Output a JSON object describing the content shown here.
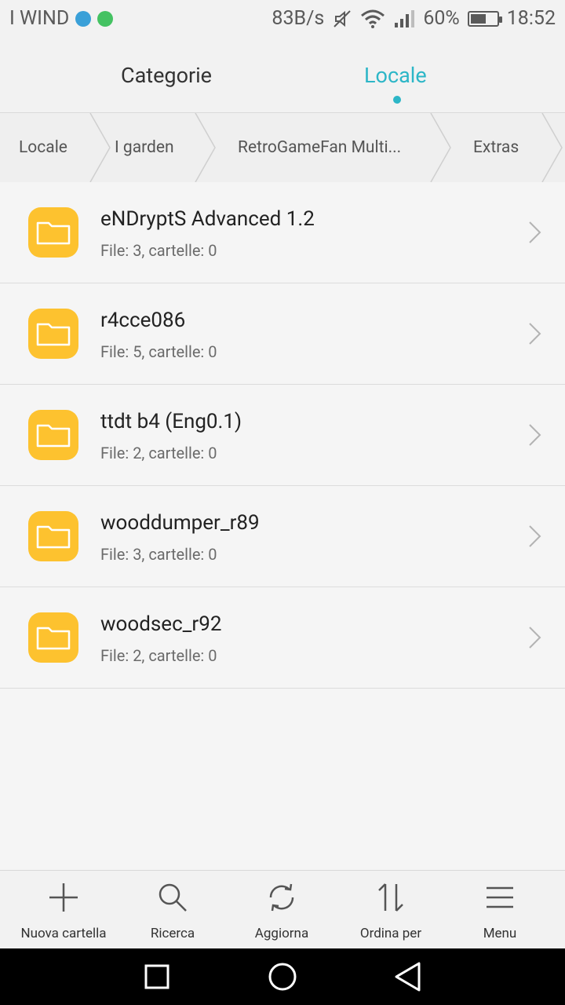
{
  "status_bar": {
    "carrier": "I WIND",
    "speed": "83B/s",
    "battery": "60%",
    "battery_level": 0.6,
    "time": "18:52",
    "icons": [
      "telegram-icon",
      "whatsapp-icon",
      "mute-icon",
      "wifi-icon",
      "signal-icon",
      "battery-icon"
    ]
  },
  "tabs": {
    "categorie": "Categorie",
    "locale": "Locale",
    "active": "locale"
  },
  "breadcrumb": [
    "Locale",
    "I garden",
    "RetroGameFan Multi...",
    "Extras"
  ],
  "folders": [
    {
      "name": "eNDryptS Advanced 1.2",
      "meta": "File: 3, cartelle: 0"
    },
    {
      "name": "r4cce086",
      "meta": "File: 5, cartelle: 0"
    },
    {
      "name": "ttdt b4 (Eng0.1)",
      "meta": "File: 2, cartelle: 0"
    },
    {
      "name": "wooddumper_r89",
      "meta": "File: 3, cartelle: 0"
    },
    {
      "name": "woodsec_r92",
      "meta": "File: 2, cartelle: 0"
    }
  ],
  "toolbar": {
    "new_folder": "Nuova cartella",
    "search": "Ricerca",
    "refresh": "Aggiorna",
    "sort": "Ordina per",
    "menu": "Menu"
  },
  "colors": {
    "accent": "#2cb6c7",
    "folder": "#fdc22f"
  }
}
